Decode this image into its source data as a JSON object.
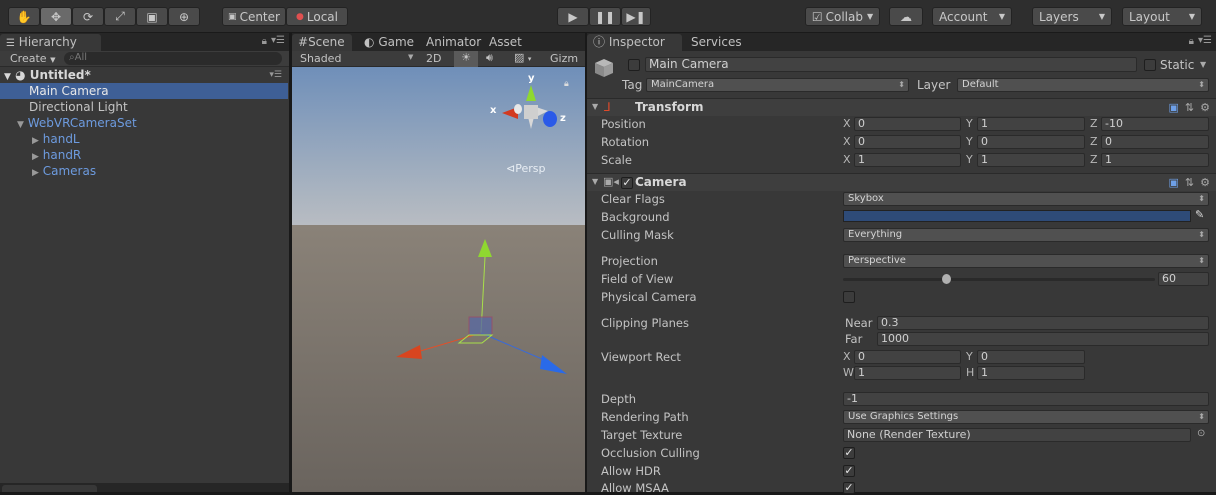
{
  "toolbar": {
    "pivot_center": "Center",
    "pivot_local": "Local",
    "collab": "Collab",
    "account": "Account",
    "layers": "Layers",
    "layout": "Layout"
  },
  "hierarchy": {
    "tab": "Hierarchy",
    "create": "Create",
    "search_placeholder": "All",
    "scene_name": "Untitled*",
    "items": [
      "Main Camera",
      "Directional Light",
      "WebVRCameraSet",
      "handL",
      "handR",
      "Cameras"
    ]
  },
  "scene": {
    "tabs": [
      "Scene",
      "Game",
      "Animator",
      "Asset St"
    ],
    "gizmos": "Gizm",
    "shading": "Shaded",
    "mode_2d": "2D",
    "gizmo_y": "y",
    "gizmo_x": "x",
    "gizmo_z": "z",
    "persp": "Persp"
  },
  "inspector": {
    "tabs": [
      "Inspector",
      "Services"
    ],
    "object_name": "Main Camera",
    "static_label": "Static",
    "tag_label": "Tag",
    "tag_value": "MainCamera",
    "layer_label": "Layer",
    "layer_value": "Default",
    "transform": {
      "title": "Transform",
      "position_label": "Position",
      "rotation_label": "Rotation",
      "scale_label": "Scale",
      "position": {
        "x": "0",
        "y": "1",
        "z": "-10"
      },
      "rotation": {
        "x": "0",
        "y": "0",
        "z": "0"
      },
      "scale": {
        "x": "1",
        "y": "1",
        "z": "1"
      }
    },
    "camera": {
      "title": "Camera",
      "clear_flags_label": "Clear Flags",
      "clear_flags": "Skybox",
      "background_label": "Background",
      "background_color": "#2e4b78",
      "culling_mask_label": "Culling Mask",
      "culling_mask": "Everything",
      "projection_label": "Projection",
      "projection": "Perspective",
      "fov_label": "Field of View",
      "fov": "60",
      "fov_fraction": 0.33,
      "physical_label": "Physical Camera",
      "clipping_label": "Clipping Planes",
      "near_label": "Near",
      "near": "0.3",
      "far_label": "Far",
      "far": "1000",
      "viewport_label": "Viewport Rect",
      "viewport": {
        "x": "0",
        "y": "0",
        "w": "1",
        "h": "1"
      },
      "depth_label": "Depth",
      "depth": "-1",
      "rendering_path_label": "Rendering Path",
      "rendering_path": "Use Graphics Settings",
      "target_texture_label": "Target Texture",
      "target_texture": "None (Render Texture)",
      "occlusion_label": "Occlusion Culling",
      "hdr_label": "Allow HDR",
      "msaa_label": "Allow MSAA"
    }
  }
}
